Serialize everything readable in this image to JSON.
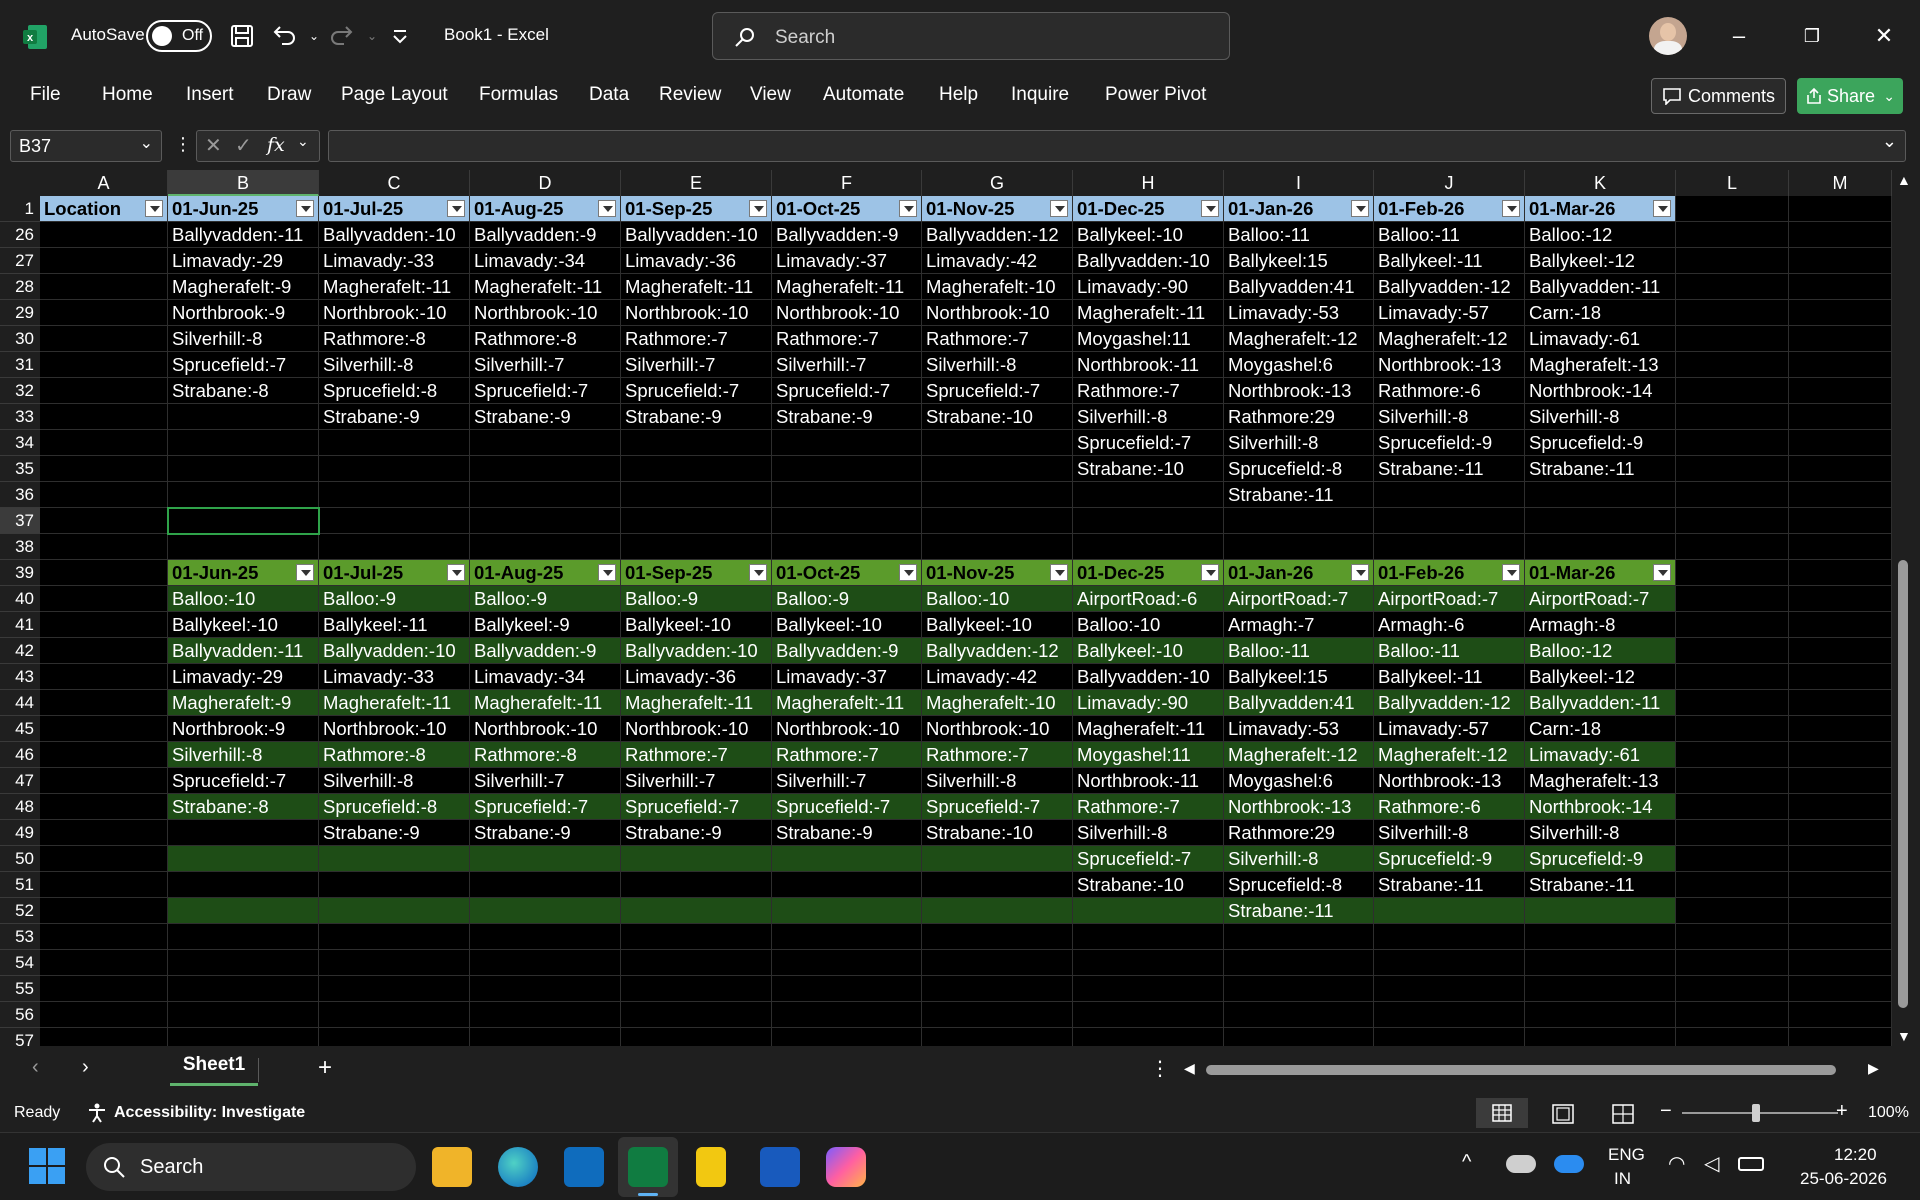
{
  "titlebar": {
    "autosave_label": "AutoSave",
    "autosave_state": "Off",
    "document_title": "Book1  -  Excel",
    "search_placeholder": "Search"
  },
  "menu": [
    "File",
    "Home",
    "Insert",
    "Draw",
    "Page Layout",
    "Formulas",
    "Data",
    "Review",
    "View",
    "Automate",
    "Help",
    "Inquire",
    "Power Pivot"
  ],
  "actions": {
    "comments": "Comments",
    "share": "Share"
  },
  "formula_bar": {
    "name_box": "B37",
    "fx": "fx",
    "value": ""
  },
  "columns": [
    "A",
    "B",
    "C",
    "D",
    "E",
    "F",
    "G",
    "H",
    "I",
    "J",
    "K",
    "L",
    "M"
  ],
  "selected_column": "B",
  "selected_row": "37",
  "table1": {
    "header_row": "1",
    "headers": [
      "Location",
      "01-Jun-25",
      "01-Jul-25",
      "01-Aug-25",
      "01-Sep-25",
      "01-Oct-25",
      "01-Nov-25",
      "01-Dec-25",
      "01-Jan-26",
      "01-Feb-26",
      "01-Mar-26"
    ],
    "rows": [
      {
        "n": "26",
        "cells": [
          "",
          "Ballyvadden:-11",
          "Ballyvadden:-10",
          "Ballyvadden:-9",
          "Ballyvadden:-10",
          "Ballyvadden:-9",
          "Ballyvadden:-12",
          "Ballykeel:-10",
          "Balloo:-11",
          "Balloo:-11",
          "Balloo:-12"
        ]
      },
      {
        "n": "27",
        "cells": [
          "",
          "Limavady:-29",
          "Limavady:-33",
          "Limavady:-34",
          "Limavady:-36",
          "Limavady:-37",
          "Limavady:-42",
          "Ballyvadden:-10",
          "Ballykeel:15",
          "Ballykeel:-11",
          "Ballykeel:-12"
        ]
      },
      {
        "n": "28",
        "cells": [
          "",
          "Magherafelt:-9",
          "Magherafelt:-11",
          "Magherafelt:-11",
          "Magherafelt:-11",
          "Magherafelt:-11",
          "Magherafelt:-10",
          "Limavady:-90",
          "Ballyvadden:41",
          "Ballyvadden:-12",
          "Ballyvadden:-11"
        ]
      },
      {
        "n": "29",
        "cells": [
          "",
          "Northbrook:-9",
          "Northbrook:-10",
          "Northbrook:-10",
          "Northbrook:-10",
          "Northbrook:-10",
          "Northbrook:-10",
          "Magherafelt:-11",
          "Limavady:-53",
          "Limavady:-57",
          "Carn:-18"
        ]
      },
      {
        "n": "30",
        "cells": [
          "",
          "Silverhill:-8",
          "Rathmore:-8",
          "Rathmore:-8",
          "Rathmore:-7",
          "Rathmore:-7",
          "Rathmore:-7",
          "Moygashel:11",
          "Magherafelt:-12",
          "Magherafelt:-12",
          "Limavady:-61"
        ]
      },
      {
        "n": "31",
        "cells": [
          "",
          "Sprucefield:-7",
          "Silverhill:-8",
          "Silverhill:-7",
          "Silverhill:-7",
          "Silverhill:-7",
          "Silverhill:-8",
          "Northbrook:-11",
          "Moygashel:6",
          "Northbrook:-13",
          "Magherafelt:-13"
        ]
      },
      {
        "n": "32",
        "cells": [
          "",
          "Strabane:-8",
          "Sprucefield:-8",
          "Sprucefield:-7",
          "Sprucefield:-7",
          "Sprucefield:-7",
          "Sprucefield:-7",
          "Rathmore:-7",
          "Northbrook:-13",
          "Rathmore:-6",
          "Northbrook:-14"
        ]
      },
      {
        "n": "33",
        "cells": [
          "",
          "",
          "Strabane:-9",
          "Strabane:-9",
          "Strabane:-9",
          "Strabane:-9",
          "Strabane:-10",
          "Silverhill:-8",
          "Rathmore:29",
          "Silverhill:-8",
          "Silverhill:-8"
        ]
      },
      {
        "n": "34",
        "cells": [
          "",
          "",
          "",
          "",
          "",
          "",
          "",
          "Sprucefield:-7",
          "Silverhill:-8",
          "Sprucefield:-9",
          "Sprucefield:-9"
        ]
      },
      {
        "n": "35",
        "cells": [
          "",
          "",
          "",
          "",
          "",
          "",
          "",
          "Strabane:-10",
          "Sprucefield:-8",
          "Strabane:-11",
          "Strabane:-11"
        ]
      },
      {
        "n": "36",
        "cells": [
          "",
          "",
          "",
          "",
          "",
          "",
          "",
          "",
          "Strabane:-11",
          "",
          ""
        ]
      },
      {
        "n": "37",
        "cells": [
          "",
          "",
          "",
          "",
          "",
          "",
          "",
          "",
          "",
          "",
          ""
        ]
      },
      {
        "n": "38",
        "cells": [
          "",
          "",
          "",
          "",
          "",
          "",
          "",
          "",
          "",
          "",
          ""
        ]
      }
    ]
  },
  "table2": {
    "header_row": "39",
    "headers": [
      "",
      "01-Jun-25",
      "01-Jul-25",
      "01-Aug-25",
      "01-Sep-25",
      "01-Oct-25",
      "01-Nov-25",
      "01-Dec-25",
      "01-Jan-26",
      "01-Feb-26",
      "01-Mar-26"
    ],
    "rows": [
      {
        "n": "40",
        "cells": [
          "",
          "Balloo:-10",
          "Balloo:-9",
          "Balloo:-9",
          "Balloo:-9",
          "Balloo:-9",
          "Balloo:-10",
          "AirportRoad:-6",
          "AirportRoad:-7",
          "AirportRoad:-7",
          "AirportRoad:-7"
        ]
      },
      {
        "n": "41",
        "cells": [
          "",
          "Ballykeel:-10",
          "Ballykeel:-11",
          "Ballykeel:-9",
          "Ballykeel:-10",
          "Ballykeel:-10",
          "Ballykeel:-10",
          "Balloo:-10",
          "Armagh:-7",
          "Armagh:-6",
          "Armagh:-8"
        ]
      },
      {
        "n": "42",
        "cells": [
          "",
          "Ballyvadden:-11",
          "Ballyvadden:-10",
          "Ballyvadden:-9",
          "Ballyvadden:-10",
          "Ballyvadden:-9",
          "Ballyvadden:-12",
          "Ballykeel:-10",
          "Balloo:-11",
          "Balloo:-11",
          "Balloo:-12"
        ]
      },
      {
        "n": "43",
        "cells": [
          "",
          "Limavady:-29",
          "Limavady:-33",
          "Limavady:-34",
          "Limavady:-36",
          "Limavady:-37",
          "Limavady:-42",
          "Ballyvadden:-10",
          "Ballykeel:15",
          "Ballykeel:-11",
          "Ballykeel:-12"
        ]
      },
      {
        "n": "44",
        "cells": [
          "",
          "Magherafelt:-9",
          "Magherafelt:-11",
          "Magherafelt:-11",
          "Magherafelt:-11",
          "Magherafelt:-11",
          "Magherafelt:-10",
          "Limavady:-90",
          "Ballyvadden:41",
          "Ballyvadden:-12",
          "Ballyvadden:-11"
        ]
      },
      {
        "n": "45",
        "cells": [
          "",
          "Northbrook:-9",
          "Northbrook:-10",
          "Northbrook:-10",
          "Northbrook:-10",
          "Northbrook:-10",
          "Northbrook:-10",
          "Magherafelt:-11",
          "Limavady:-53",
          "Limavady:-57",
          "Carn:-18"
        ]
      },
      {
        "n": "46",
        "cells": [
          "",
          "Silverhill:-8",
          "Rathmore:-8",
          "Rathmore:-8",
          "Rathmore:-7",
          "Rathmore:-7",
          "Rathmore:-7",
          "Moygashel:11",
          "Magherafelt:-12",
          "Magherafelt:-12",
          "Limavady:-61"
        ]
      },
      {
        "n": "47",
        "cells": [
          "",
          "Sprucefield:-7",
          "Silverhill:-8",
          "Silverhill:-7",
          "Silverhill:-7",
          "Silverhill:-7",
          "Silverhill:-8",
          "Northbrook:-11",
          "Moygashel:6",
          "Northbrook:-13",
          "Magherafelt:-13"
        ]
      },
      {
        "n": "48",
        "cells": [
          "",
          "Strabane:-8",
          "Sprucefield:-8",
          "Sprucefield:-7",
          "Sprucefield:-7",
          "Sprucefield:-7",
          "Sprucefield:-7",
          "Rathmore:-7",
          "Northbrook:-13",
          "Rathmore:-6",
          "Northbrook:-14"
        ]
      },
      {
        "n": "49",
        "cells": [
          "",
          "",
          "Strabane:-9",
          "Strabane:-9",
          "Strabane:-9",
          "Strabane:-9",
          "Strabane:-10",
          "Silverhill:-8",
          "Rathmore:29",
          "Silverhill:-8",
          "Silverhill:-8"
        ]
      },
      {
        "n": "50",
        "cells": [
          "",
          "",
          "",
          "",
          "",
          "",
          "",
          "Sprucefield:-7",
          "Silverhill:-8",
          "Sprucefield:-9",
          "Sprucefield:-9"
        ]
      },
      {
        "n": "51",
        "cells": [
          "",
          "",
          "",
          "",
          "",
          "",
          "",
          "Strabane:-10",
          "Sprucefield:-8",
          "Strabane:-11",
          "Strabane:-11"
        ]
      },
      {
        "n": "52",
        "cells": [
          "",
          "",
          "",
          "",
          "",
          "",
          "",
          "",
          "Strabane:-11",
          "",
          ""
        ]
      }
    ]
  },
  "empty_rows": [
    "53",
    "54",
    "55",
    "56",
    "57"
  ],
  "sheet_tabs": [
    "Sheet1"
  ],
  "status": {
    "ready": "Ready",
    "accessibility": "Accessibility: Investigate",
    "zoom": "100%"
  },
  "taskbar": {
    "search": "Search",
    "lang1": "ENG",
    "lang2": "IN",
    "time": "12:20",
    "date": "25-06-2026"
  },
  "colors": {
    "header_blue": "#9dc3e6",
    "header_green": "#5b9b2b",
    "band_dark": "#1e4d16",
    "accent_green": "#3ca55c"
  }
}
